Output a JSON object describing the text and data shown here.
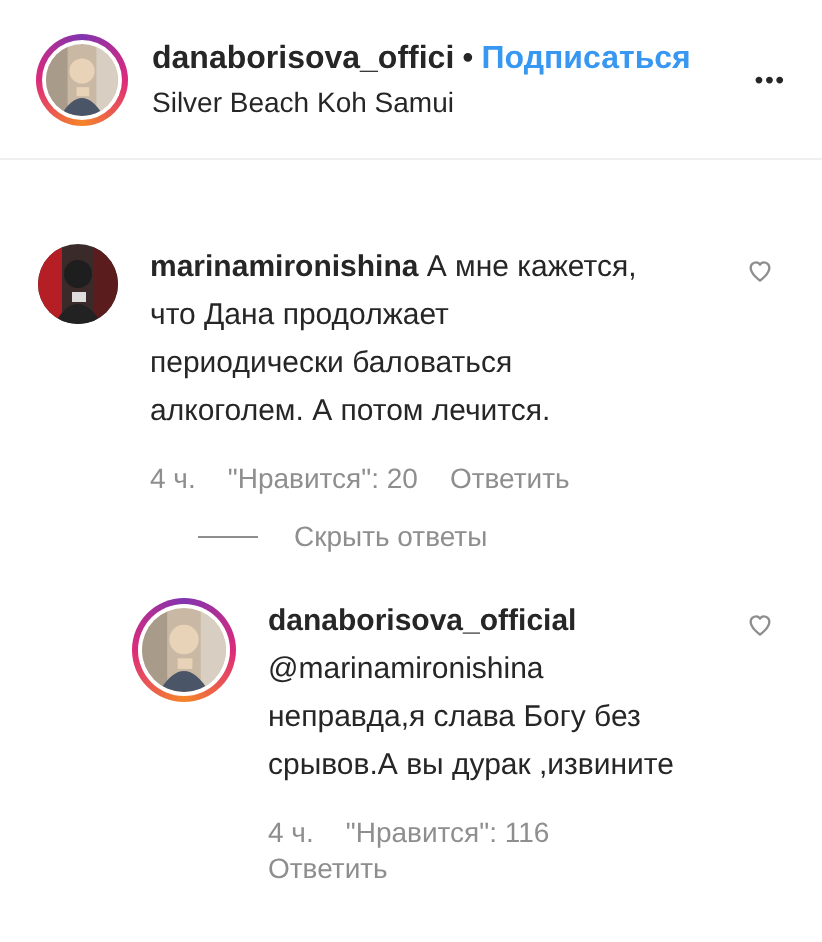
{
  "header": {
    "username": "danaborisova_offici",
    "separator": "•",
    "follow": "Подписаться",
    "location": "Silver Beach Koh Samui",
    "more": "•••"
  },
  "comments": [
    {
      "username": "marinamironishina",
      "text": "А мне кажется, что Дана продолжает периодически баловаться алкоголем. А потом лечится.",
      "time": "4 ч.",
      "likes": "\"Нравится\": 20",
      "reply": "Ответить",
      "liked": false,
      "story_ring": false,
      "hide_replies": "Скрыть ответы",
      "replies": [
        {
          "username": "danaborisova_official",
          "text": "@marinamironishina неправда,я слава Богу без срывов.А вы дурак ,извините",
          "time": "4 ч.",
          "likes": "\"Нравится\": 116",
          "reply": "Ответить",
          "liked": false,
          "story_ring": true
        }
      ]
    }
  ]
}
